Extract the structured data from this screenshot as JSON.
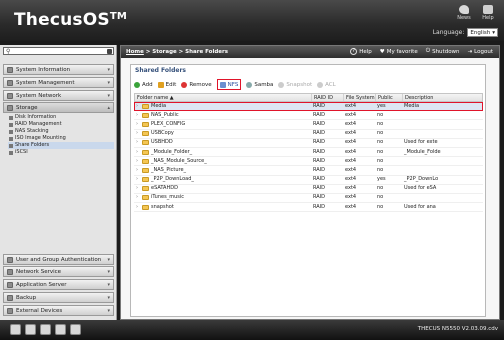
{
  "app": {
    "logo": "ThecusOS",
    "trademark": "TM"
  },
  "header": {
    "icons": [
      {
        "name": "news-icon",
        "label": "News"
      },
      {
        "name": "help-icon",
        "label": "Help"
      }
    ],
    "language_label": "Language:",
    "language_value": "English"
  },
  "breadcrumb": {
    "home": "Home",
    "rest": " > Storage > Share Folders"
  },
  "toplinks": {
    "help": "Help",
    "favorite": "My favorite",
    "shutdown": "Shutdown",
    "logout": "Logout"
  },
  "sidebar": {
    "search_placeholder": "",
    "top_categories": [
      "System Information",
      "System Management",
      "System Network",
      "Storage"
    ],
    "storage_items": [
      "Disk Information",
      "RAID Management",
      "NAS Stacking",
      "ISO Image Mounting",
      "Share Folders",
      "iSCSI"
    ],
    "bottom_categories": [
      "User and Group Authentication",
      "Network Service",
      "Application Server",
      "Backup",
      "External Devices"
    ]
  },
  "panel": {
    "title": "Shared Folders",
    "toolbar": {
      "add": "Add",
      "edit": "Edit",
      "remove": "Remove",
      "nfs": "NFS",
      "samba": "Samba",
      "snapshot": "Snapshot",
      "acl": "ACL"
    },
    "columns": [
      "Folder name ▲",
      "RAID ID",
      "File System",
      "Public",
      "Description"
    ],
    "rows": [
      {
        "name": "Media",
        "raid": "RAID",
        "fs": "ext4",
        "public": "yes",
        "desc": "Media"
      },
      {
        "name": "NAS_Public",
        "raid": "RAID",
        "fs": "ext4",
        "public": "no",
        "desc": ""
      },
      {
        "name": "PLEX_CONFIG",
        "raid": "RAID",
        "fs": "ext4",
        "public": "no",
        "desc": ""
      },
      {
        "name": "USBCopy",
        "raid": "RAID",
        "fs": "ext4",
        "public": "no",
        "desc": ""
      },
      {
        "name": "USBHDD",
        "raid": "RAID",
        "fs": "ext4",
        "public": "no",
        "desc": "Used for exte"
      },
      {
        "name": "_Module_Folder_",
        "raid": "RAID",
        "fs": "ext4",
        "public": "no",
        "desc": "_Module_Folde"
      },
      {
        "name": "_NAS_Module_Source_",
        "raid": "RAID",
        "fs": "ext4",
        "public": "no",
        "desc": ""
      },
      {
        "name": "_NAS_Picture_",
        "raid": "RAID",
        "fs": "ext4",
        "public": "no",
        "desc": ""
      },
      {
        "name": "_P2P_DownLoad_",
        "raid": "RAID",
        "fs": "ext4",
        "public": "yes",
        "desc": "_P2P_DownLo"
      },
      {
        "name": "eSATAHDD",
        "raid": "RAID",
        "fs": "ext4",
        "public": "no",
        "desc": "Used for eSA"
      },
      {
        "name": "iTunes_music",
        "raid": "RAID",
        "fs": "ext4",
        "public": "no",
        "desc": ""
      },
      {
        "name": "snapshot",
        "raid": "RAID",
        "fs": "ext4",
        "public": "no",
        "desc": "Used for ana"
      }
    ]
  },
  "footer": {
    "version": "THECUS N5550 V2.03.09.cdv"
  }
}
